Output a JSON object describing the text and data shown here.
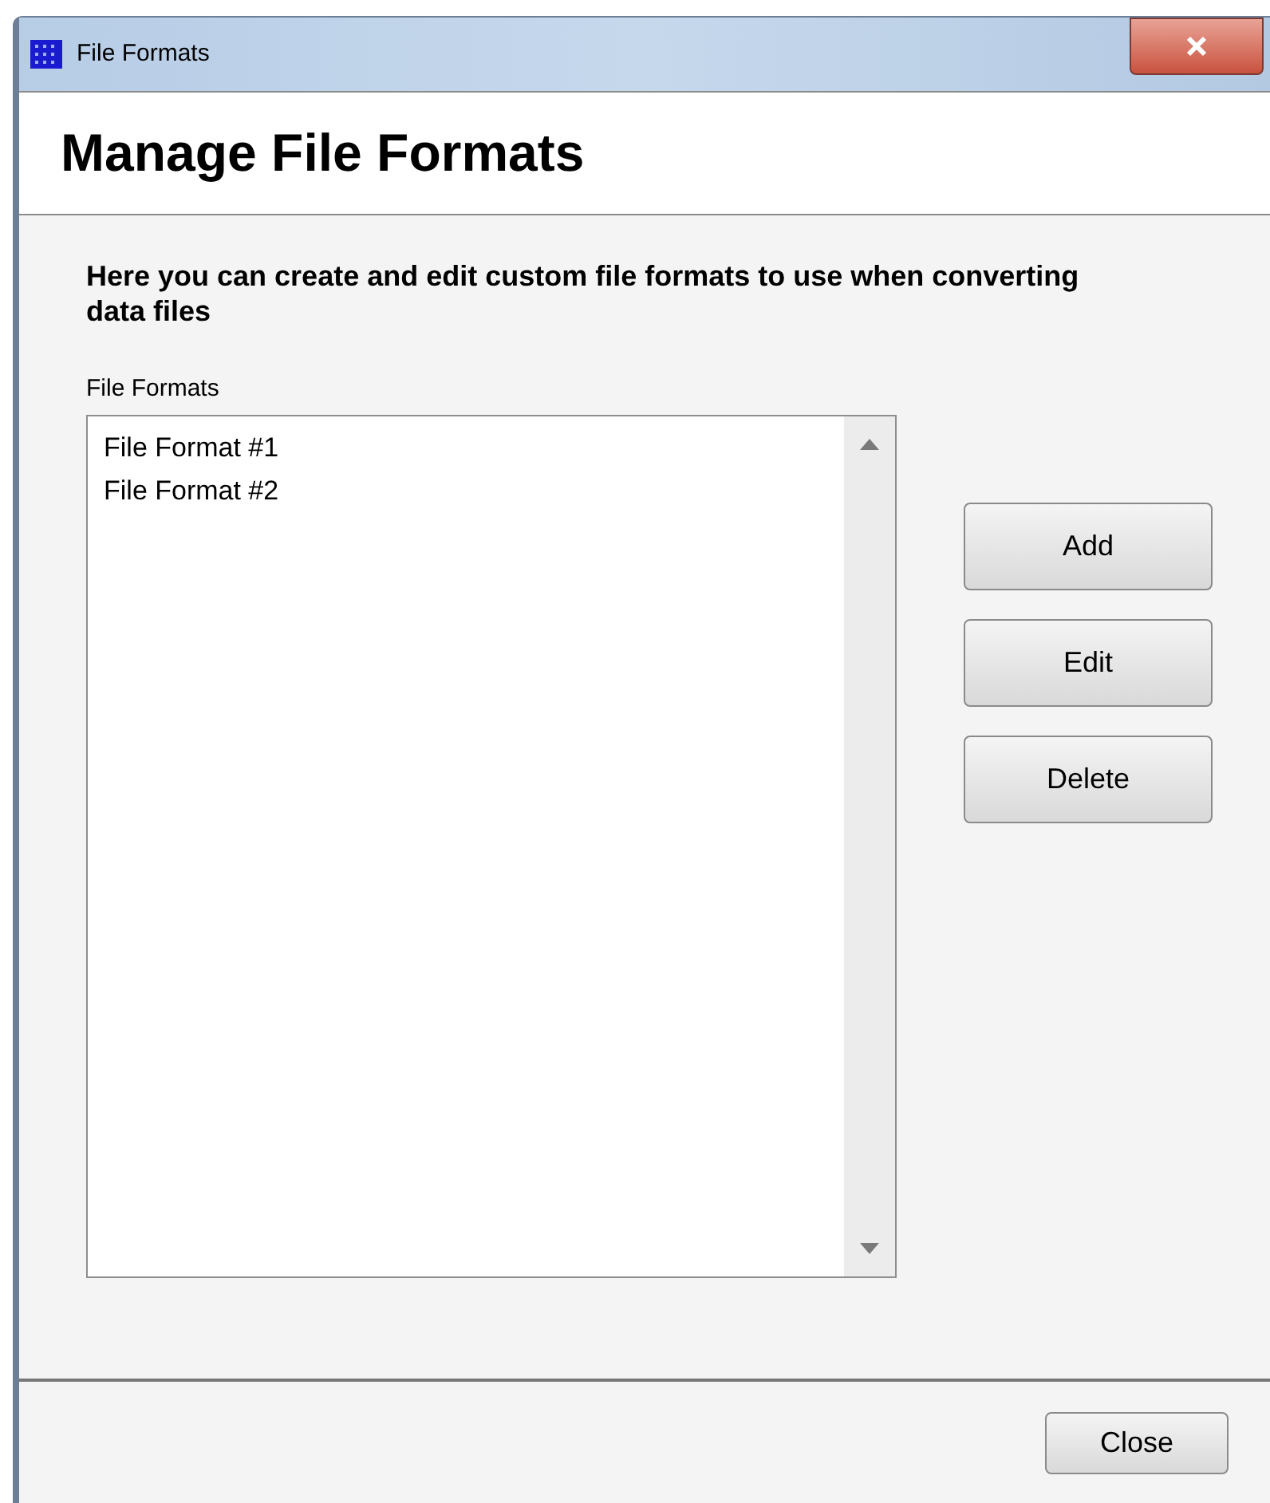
{
  "window": {
    "title": "File Formats"
  },
  "header": {
    "title": "Manage File Formats"
  },
  "description": "Here you can create and edit custom file formats to use when converting data files",
  "list": {
    "label": "File Formats",
    "items": [
      {
        "label": "File Format #1"
      },
      {
        "label": "File Format #2"
      }
    ]
  },
  "buttons": [
    {
      "label": "Add"
    },
    {
      "label": "Edit"
    },
    {
      "label": "Delete"
    }
  ],
  "footer": {
    "buttons": [
      {
        "label": "Close"
      }
    ]
  }
}
